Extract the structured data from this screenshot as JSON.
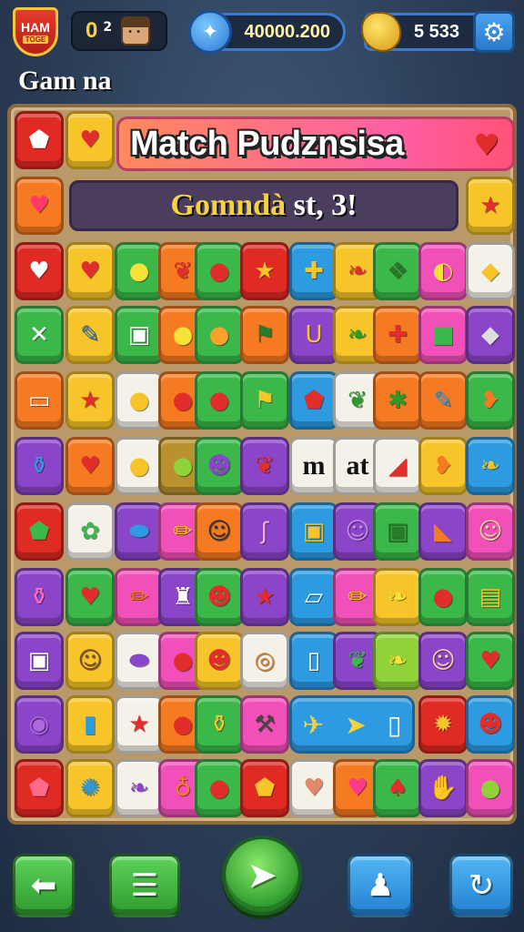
{
  "hud": {
    "badge_line1": "HAM",
    "badge_line2": "TOGE",
    "lives_value": "0",
    "lives_count": "2",
    "coins": "40000.200",
    "gold": "5 533",
    "settings_icon": "gear-icon"
  },
  "game_label": "Gam na",
  "title": "Match Pudznsisa",
  "subtitle_prefix": "Gomndà",
  "subtitle_rest": " st, 3!",
  "tile_text": {
    "m": "m",
    "at": "at"
  },
  "bottom_bar": {
    "back_icon": "arrow-left-icon",
    "menu_icon": "list-icon",
    "play_icon": "send-arrow-icon",
    "friends_icon": "people-icon",
    "refresh_icon": "refresh-icon"
  },
  "colors": {
    "board": "#b9986a",
    "title_banner": "#ff5fa4",
    "button_green": "#3cb84a",
    "button_blue": "#2e9ae0"
  }
}
